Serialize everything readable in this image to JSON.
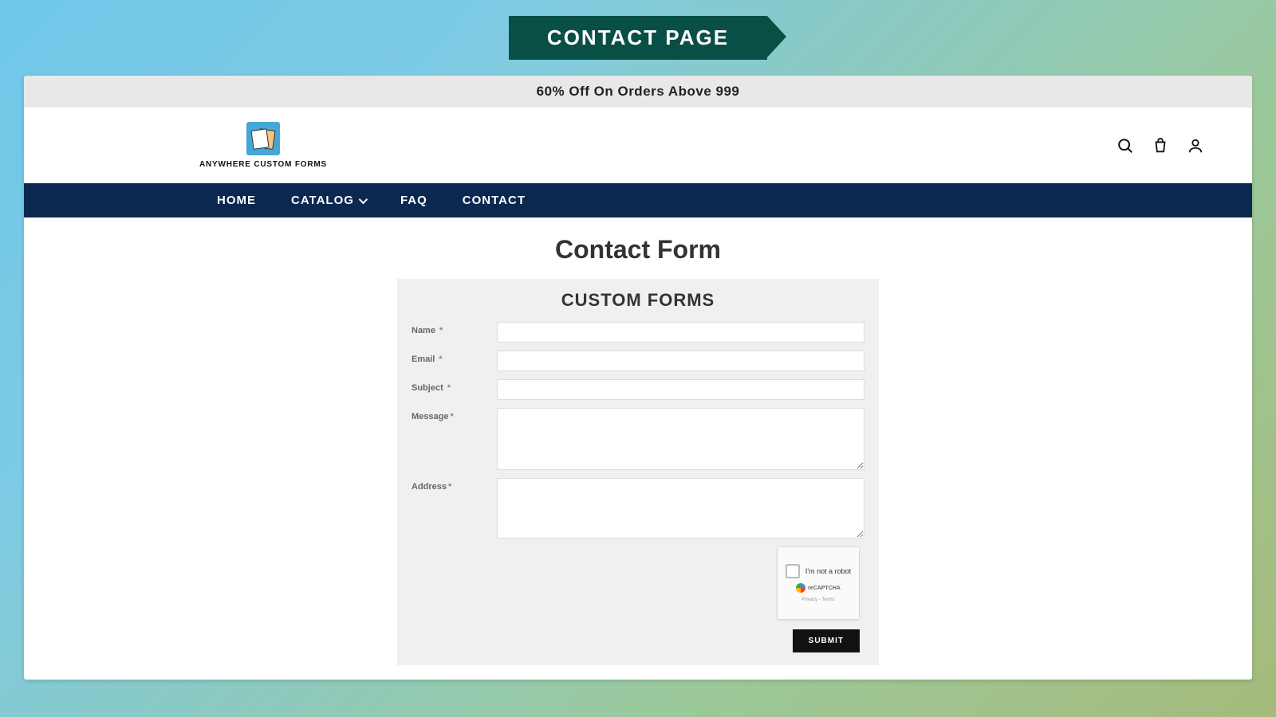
{
  "ribbon": {
    "text": "CONTACT PAGE"
  },
  "announce": {
    "text": "60% Off On Orders Above 999"
  },
  "logo": {
    "name": "ANYWHERE CUSTOM FORMS"
  },
  "nav": {
    "home": "HOME",
    "catalog": "CATALOG",
    "faq": "FAQ",
    "contact": "CONTACT"
  },
  "main": {
    "title": "Contact Form",
    "form_title": "CUSTOM FORMS"
  },
  "form": {
    "name_label": "Name",
    "email_label": "Email",
    "subject_label": "Subject",
    "message_label": "Message",
    "address_label": "Address",
    "req": "*"
  },
  "captcha": {
    "label": "I'm not a robot",
    "brand": "reCAPTCHA",
    "terms": "Privacy - Terms"
  },
  "submit": {
    "label": "SUBMIT"
  }
}
